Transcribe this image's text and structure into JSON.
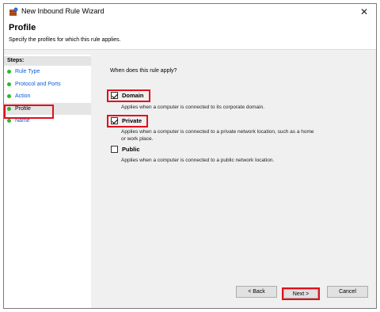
{
  "window": {
    "title": "New Inbound Rule Wizard"
  },
  "header": {
    "title": "Profile",
    "description": "Specify the profiles for which this rule applies."
  },
  "steps": {
    "heading": "Steps:",
    "items": [
      {
        "label": "Rule Type"
      },
      {
        "label": "Protocol and Ports"
      },
      {
        "label": "Action"
      },
      {
        "label": "Profile"
      },
      {
        "label": "Name"
      }
    ]
  },
  "main": {
    "question": "When does this rule apply?",
    "options": [
      {
        "label": "Domain",
        "checked": true,
        "description": "Applies when a computer is connected to its corporate domain."
      },
      {
        "label": "Private",
        "checked": true,
        "description_line1": "Applies when a computer is connected to a private network location, such as a home",
        "description_line2": "or work place."
      },
      {
        "label": "Public",
        "checked": false,
        "description": "Applies when a computer is connected to a public network location."
      }
    ]
  },
  "buttons": {
    "back": "< Back",
    "next": "Next >",
    "cancel": "Cancel"
  },
  "colors": {
    "highlight": "#e0101e",
    "step_link": "#0b5ed7",
    "step_dot": "#2eb82e"
  }
}
